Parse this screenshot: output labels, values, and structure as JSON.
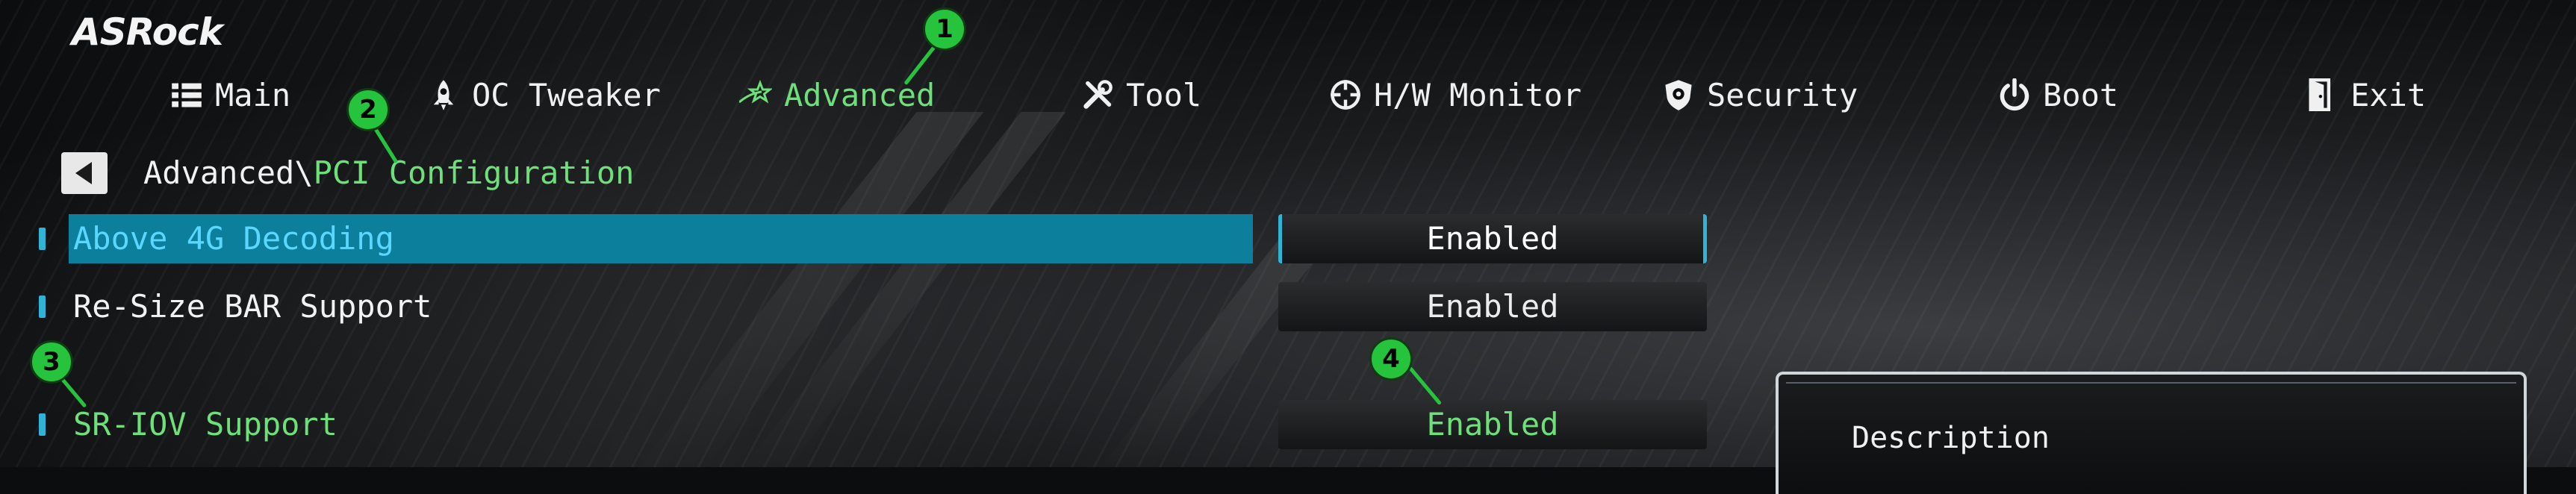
{
  "brand": {
    "logo": "ASRock"
  },
  "nav": {
    "items": [
      {
        "label": "Main",
        "icon": "list-icon"
      },
      {
        "label": "OC Tweaker",
        "icon": "rocket-icon"
      },
      {
        "label": "Advanced",
        "icon": "star-icon",
        "active": true
      },
      {
        "label": "Tool",
        "icon": "tools-icon"
      },
      {
        "label": "H/W Monitor",
        "icon": "crosshair-icon"
      },
      {
        "label": "Security",
        "icon": "shield-icon"
      },
      {
        "label": "Boot",
        "icon": "power-icon"
      },
      {
        "label": "Exit",
        "icon": "exit-door-icon"
      }
    ]
  },
  "breadcrumb": {
    "parent": "Advanced\\",
    "current": "PCI Configuration"
  },
  "settings": [
    {
      "label": "Above 4G Decoding",
      "value": "Enabled"
    },
    {
      "label": "Re-Size BAR Support",
      "value": "Enabled"
    },
    {
      "label": "SR-IOV Support",
      "value": "Enabled"
    }
  ],
  "description": {
    "title": "Description"
  },
  "annotations": [
    "1",
    "2",
    "3",
    "4"
  ],
  "colors": {
    "accent_green": "#6ee07a",
    "highlight_blue": "#0b7f9c",
    "marker_blue": "#2fb4d6",
    "badge_green": "#25c43c"
  }
}
